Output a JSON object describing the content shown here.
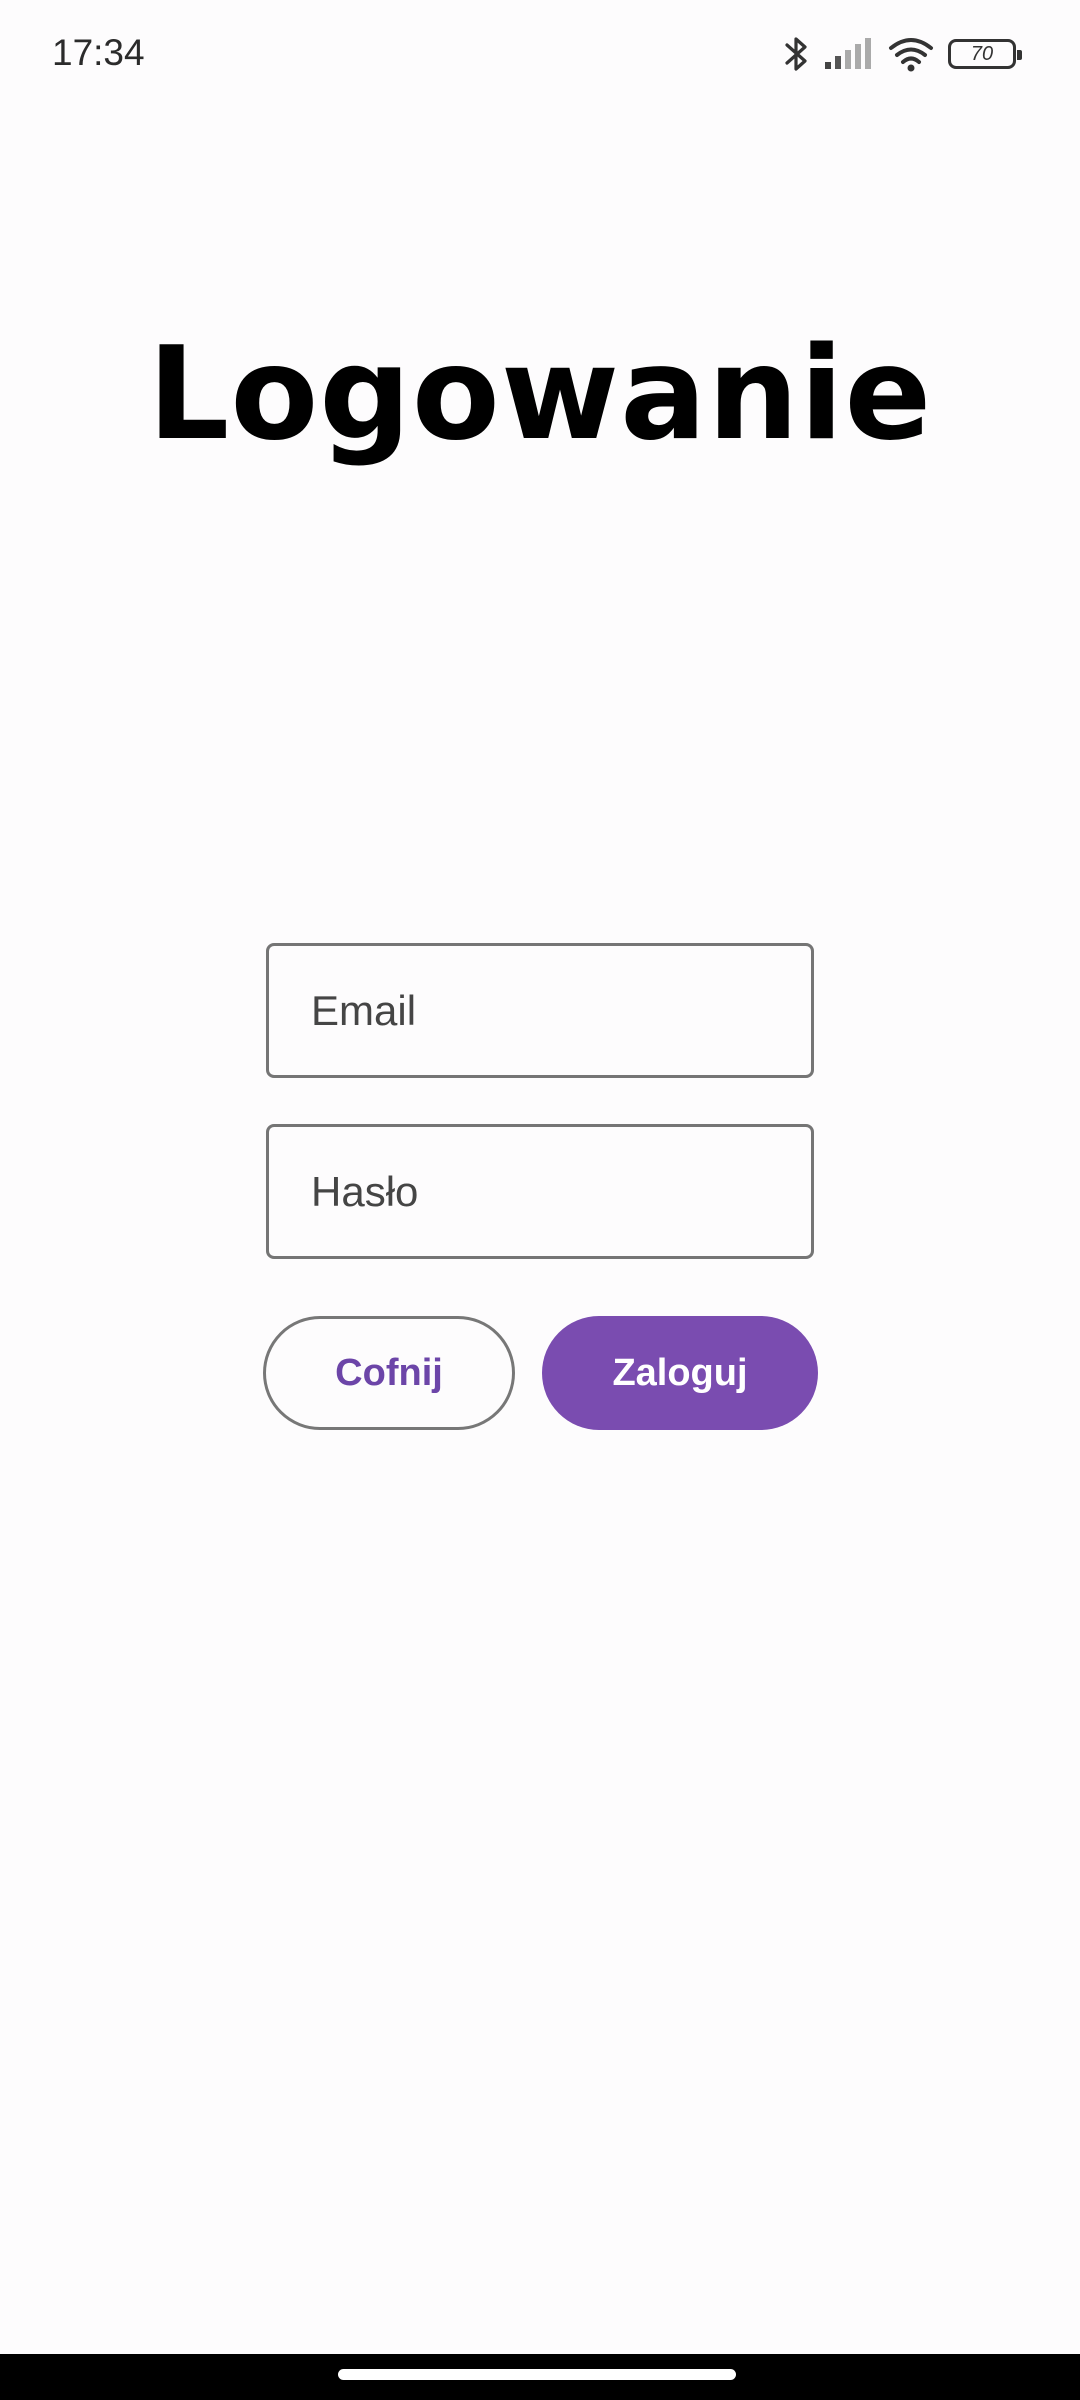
{
  "status_bar": {
    "time": "17:34",
    "battery_level": "70",
    "icons": [
      "bluetooth-icon",
      "signal-icon",
      "wifi-icon",
      "battery-icon"
    ]
  },
  "title": "Logowanie",
  "form": {
    "email_placeholder": "Email",
    "password_placeholder": "Hasło"
  },
  "buttons": {
    "back_label": "Cofnij",
    "login_label": "Zaloguj"
  },
  "colors": {
    "accent": "#7a4cb0",
    "accent_text": "#6c45a8",
    "background": "#fdfcfd"
  }
}
